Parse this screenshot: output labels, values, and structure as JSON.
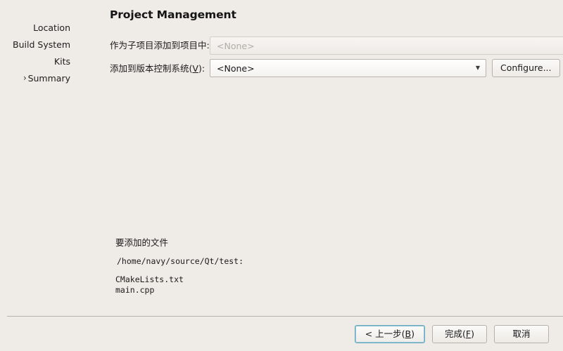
{
  "window": {
    "title": "Project Management",
    "background_color": "#efebe7"
  },
  "sidebar": {
    "items": [
      {
        "label": "Location",
        "chevron": "",
        "current": false
      },
      {
        "label": "Build System",
        "chevron": "",
        "current": false
      },
      {
        "label": "Kits",
        "chevron": "",
        "current": false
      },
      {
        "label": "Summary",
        "chevron": "›",
        "current": true
      }
    ]
  },
  "form": {
    "subproject": {
      "label_text": "作为子项目添加到项目中:",
      "value": "<None>",
      "enabled": false,
      "arrow": "▼"
    },
    "vcs": {
      "label_prefix": "添加到版本控制系统(",
      "label_mnemonic": "V",
      "label_suffix": "):",
      "value": "<None>",
      "enabled": true,
      "arrow": "▼"
    },
    "configure_button": {
      "label": "Configure..."
    }
  },
  "files_summary": {
    "heading": "要添加的文件",
    "path": "/home/navy/source/Qt/test:",
    "files": "CMakeLists.txt\nmain.cpp"
  },
  "footer": {
    "buttons": [
      {
        "prefix": "< 上一步(",
        "mnemonic": "B",
        "suffix": ")",
        "focused": true,
        "name": "back-button"
      },
      {
        "prefix": "完成(",
        "mnemonic": "F",
        "suffix": ")",
        "focused": false,
        "name": "finish-button"
      },
      {
        "prefix": "取消",
        "mnemonic": "",
        "suffix": "",
        "focused": false,
        "name": "cancel-button"
      }
    ]
  }
}
